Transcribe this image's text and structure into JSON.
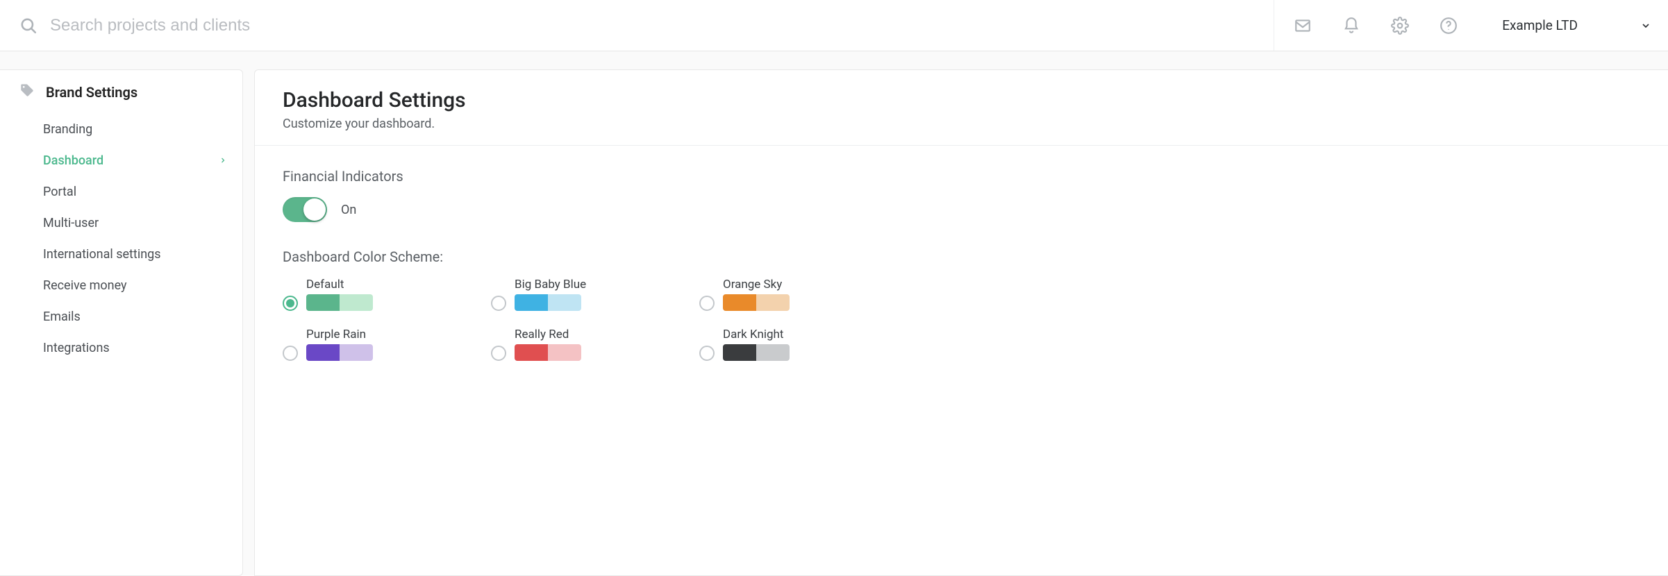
{
  "search": {
    "placeholder": "Search projects and clients"
  },
  "company": {
    "name": "Example LTD"
  },
  "sidebar": {
    "title": "Brand Settings",
    "items": [
      {
        "label": "Branding",
        "active": false
      },
      {
        "label": "Dashboard",
        "active": true
      },
      {
        "label": "Portal",
        "active": false
      },
      {
        "label": "Multi-user",
        "active": false
      },
      {
        "label": "International settings",
        "active": false
      },
      {
        "label": "Receive money",
        "active": false
      },
      {
        "label": "Emails",
        "active": false
      },
      {
        "label": "Integrations",
        "active": false
      }
    ]
  },
  "panel": {
    "title": "Dashboard Settings",
    "subtitle": "Customize your dashboard.",
    "financial": {
      "label": "Financial Indicators",
      "state_text": "On",
      "on": true
    },
    "color_scheme": {
      "label": "Dashboard Color Scheme:",
      "options": [
        {
          "name": "Default",
          "c1": "#5bb58c",
          "c2": "#bfe9cf",
          "selected": true
        },
        {
          "name": "Big Baby Blue",
          "c1": "#3fb2e3",
          "c2": "#bfe4f3",
          "selected": false
        },
        {
          "name": "Orange Sky",
          "c1": "#e98a2a",
          "c2": "#f3d2ad",
          "selected": false
        },
        {
          "name": "Purple Rain",
          "c1": "#6a48c6",
          "c2": "#cfc1e9",
          "selected": false
        },
        {
          "name": "Really Red",
          "c1": "#e04f50",
          "c2": "#f4c2c4",
          "selected": false
        },
        {
          "name": "Dark Knight",
          "c1": "#3a3c3e",
          "c2": "#c9cbcd",
          "selected": false
        }
      ]
    }
  }
}
